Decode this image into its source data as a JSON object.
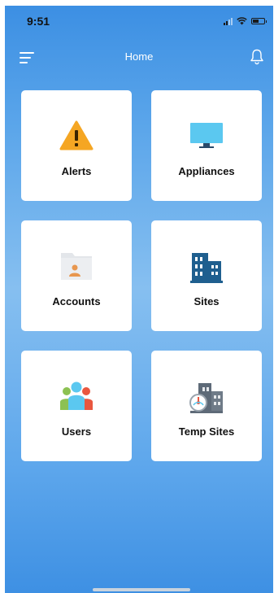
{
  "status_bar": {
    "time": "9:51",
    "battery_level": 0.55
  },
  "nav": {
    "title": "Home",
    "menu_icon": "hamburger-menu-icon",
    "bell_icon": "bell-icon"
  },
  "tiles": [
    {
      "label": "Alerts",
      "icon": "warning-icon",
      "color": "#f5a623"
    },
    {
      "label": "Appliances",
      "icon": "monitor-icon",
      "color": "#5bc8f0"
    },
    {
      "label": "Accounts",
      "icon": "folder-user-icon",
      "color": "#e8974f"
    },
    {
      "label": "Sites",
      "icon": "building-icon",
      "color": "#1f5f8f"
    },
    {
      "label": "Users",
      "icon": "user-group-icon",
      "color": "#5bc8f0"
    },
    {
      "label": "Temp Sites",
      "icon": "building-thermometer-icon",
      "color": "#5e6a78"
    }
  ],
  "colors": {
    "background_top": "#3c8fe3",
    "background_mid": "#86bff0",
    "tile_background": "#ffffff"
  }
}
